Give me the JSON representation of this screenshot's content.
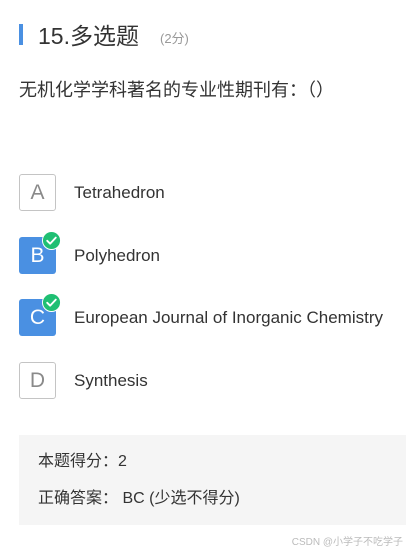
{
  "question": {
    "title": "15.多选题",
    "score": "(2分)",
    "stem": "无机化学学科著名的专业性期刊有：（）"
  },
  "options": [
    {
      "letter": "A",
      "text": "Tetrahedron",
      "selected": false
    },
    {
      "letter": "B",
      "text": "Polyhedron",
      "selected": true
    },
    {
      "letter": "C",
      "text": "European Journal of Inorganic Chemistry",
      "selected": true
    },
    {
      "letter": "D",
      "text": "Synthesis",
      "selected": false
    }
  ],
  "result": {
    "score_line": "本题得分：2",
    "answer_line": "正确答案：  BC (少选不得分)"
  },
  "watermark": "CSDN @小学子不吃学子",
  "colors": {
    "accent": "#4a90e2",
    "check": "#1fbf73",
    "result_bg": "#f5f5f5"
  },
  "icons": {
    "correct": "check-circle-icon"
  }
}
